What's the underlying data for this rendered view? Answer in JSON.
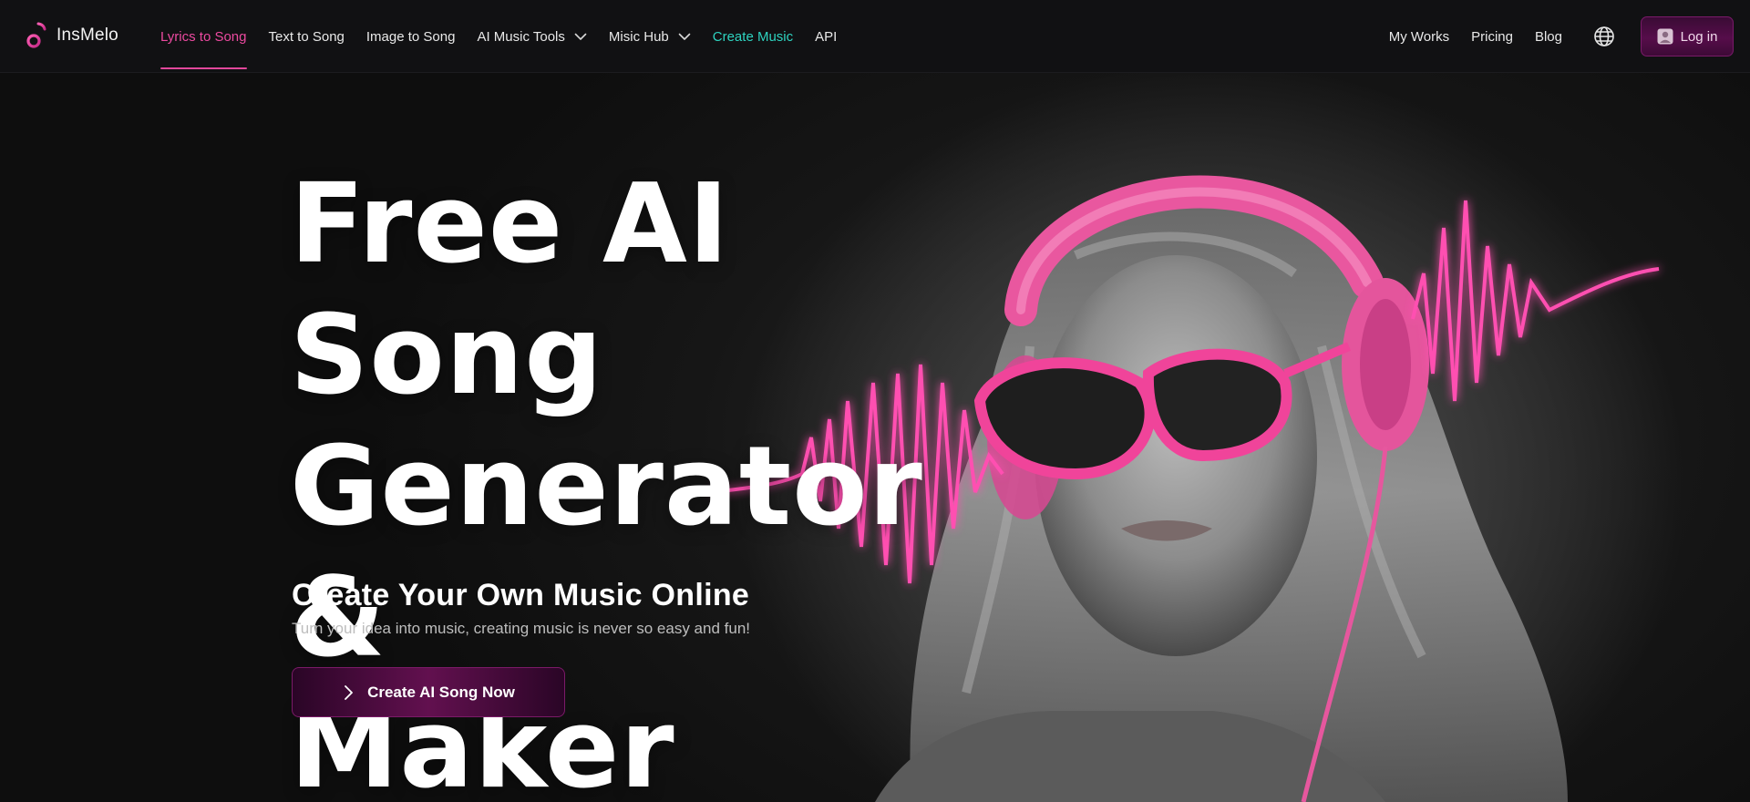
{
  "brand": {
    "name": "InsMelo",
    "logo_icon": "music-note-logo"
  },
  "nav": {
    "links": [
      {
        "label": "Lyrics to Song",
        "active": true
      },
      {
        "label": "Text to Song"
      },
      {
        "label": "Image to Song"
      },
      {
        "label": "AI Music Tools",
        "dropdown": true
      },
      {
        "label": "Misic Hub",
        "dropdown": true
      },
      {
        "label": "Create Music",
        "highlight": "#2ed3c0"
      },
      {
        "label": "API"
      }
    ],
    "right": {
      "my_works": "My Works",
      "pricing": "Pricing",
      "blog": "Blog",
      "language_icon": "globe-icon",
      "login": "Log in"
    }
  },
  "hero": {
    "title_lines": [
      "Free AI Song",
      "Generator &",
      "Maker"
    ],
    "subtitle": "Create Your Own Music Online",
    "description": "Turn your idea into music, creating music is never so easy and fun!",
    "cta_label": "Create AI Song Now"
  },
  "colors": {
    "accent_pink": "#e2489b",
    "teal": "#2ed3c0",
    "background": "#0b0b0c",
    "button_purple": "#560d4a"
  }
}
